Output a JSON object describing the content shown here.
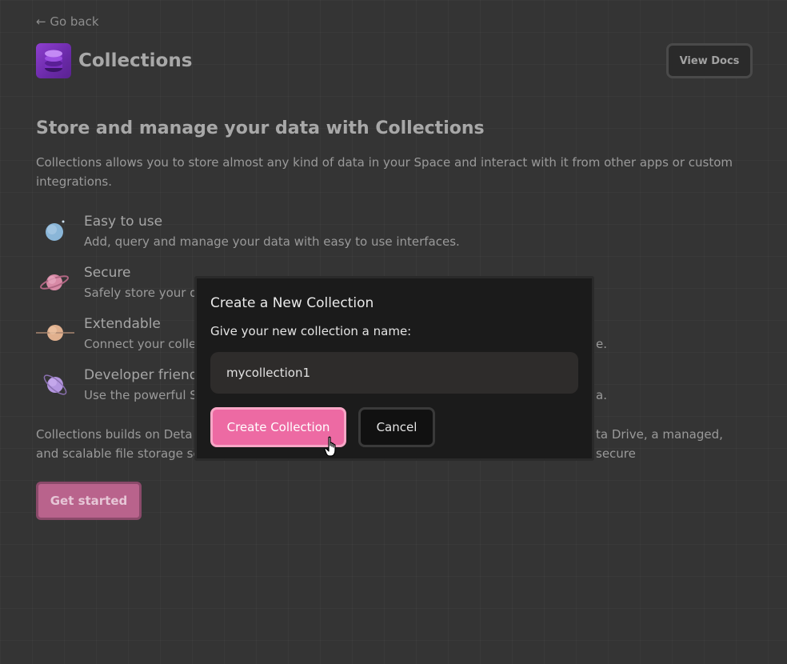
{
  "nav": {
    "back_label": "← Go back"
  },
  "header": {
    "title": "Collections",
    "view_docs_label": "View Docs",
    "app_icon": "database-icon"
  },
  "main": {
    "headline": "Store and manage your data with Collections",
    "intro": "Collections allows you to store almost any kind of data in your Space and interact with it from other apps or custom integrations.",
    "features": [
      {
        "icon": "blue-planet-icon",
        "title": "Easy to use",
        "description": "Add, query and manage your data with easy to use interfaces."
      },
      {
        "icon": "pink-ringed-planet-icon",
        "title": "Secure",
        "description": "Safely store your da"
      },
      {
        "icon": "peach-ringed-planet-icon",
        "title": "Extendable",
        "description": "Connect your collec",
        "description_tail": "e."
      },
      {
        "icon": "purple-ringed-planet-icon",
        "title": "Developer friendly",
        "description": "Use the powerful SD",
        "description_tail": "a."
      }
    ],
    "outro_start": "Collections builds on Deta B",
    "outro_end": "ta Drive, a managed, secure",
    "outro_line2": "and scalable file storage serv",
    "get_started_label": "Get started"
  },
  "modal": {
    "title": "Create a New Collection",
    "prompt": "Give your new collection a name:",
    "input_value": "mycollection1",
    "create_label": "Create Collection",
    "cancel_label": "Cancel"
  },
  "colors": {
    "background": "#343434",
    "accent_pink": "#ed6aa3",
    "modal_background": "#1b1b1b",
    "app_icon_purple": "#8e3fcf"
  }
}
